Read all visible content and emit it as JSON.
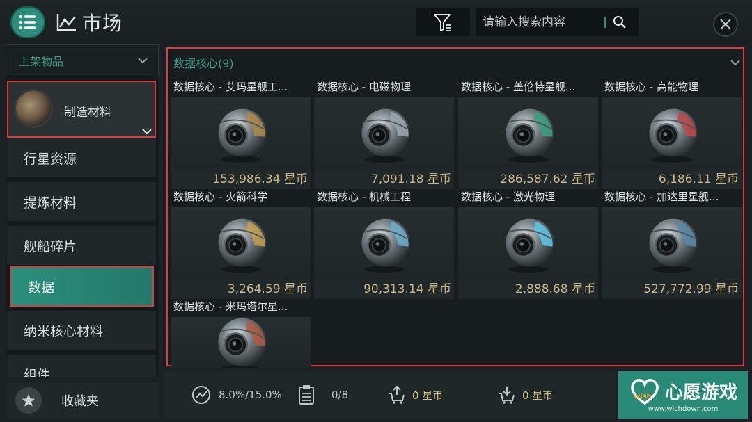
{
  "header": {
    "title": "市场",
    "search_placeholder": "请输入搜索内容"
  },
  "sidebar": {
    "dropdown_label": "上架物品",
    "selected_category": "制造材料",
    "items": [
      {
        "label": "行星资源",
        "active": false
      },
      {
        "label": "提炼材料",
        "active": false
      },
      {
        "label": "舰船碎片",
        "active": false
      },
      {
        "label": "数据",
        "active": true
      },
      {
        "label": "纳米核心材料",
        "active": false
      },
      {
        "label": "组件",
        "active": false
      }
    ],
    "favorites_label": "收藏夹"
  },
  "main": {
    "group_title": "数据核心(9)",
    "items": [
      {
        "name": "数据核心 - 艾玛星舰工...",
        "price": "153,986.34 星币",
        "accent": "#b08a4a"
      },
      {
        "name": "数据核心 - 电磁物理",
        "price": "7,091.18 星币",
        "accent": "#9fa8b0"
      },
      {
        "name": "数据核心 - 盖伦特星舰...",
        "price": "286,587.62 星币",
        "accent": "#3aa080"
      },
      {
        "name": "数据核心 - 高能物理",
        "price": "6,186.11 星币",
        "accent": "#c04848"
      },
      {
        "name": "数据核心 - 火箭科学",
        "price": "3,264.59 星币",
        "accent": "#c8a050"
      },
      {
        "name": "数据核心 - 机械工程",
        "price": "90,313.14 星币",
        "accent": "#70b0d0"
      },
      {
        "name": "数据核心 - 激光物理",
        "price": "2,888.68 星币",
        "accent": "#60c8e8"
      },
      {
        "name": "数据核心 - 加达里星舰...",
        "price": "527,772.99 星币",
        "accent": "#5a8aa8"
      },
      {
        "name": "数据核心 - 米玛塔尔星...",
        "price": "",
        "accent": "#b05a40"
      }
    ]
  },
  "bottom": {
    "tax": "8.0%/15.0%",
    "orders": "0/8",
    "sell_amount": "0 星币",
    "buy_amount": "0 星币"
  },
  "watermark": {
    "brand": "心愿游戏",
    "tag": "wish",
    "url": "www.wishdown.com"
  }
}
